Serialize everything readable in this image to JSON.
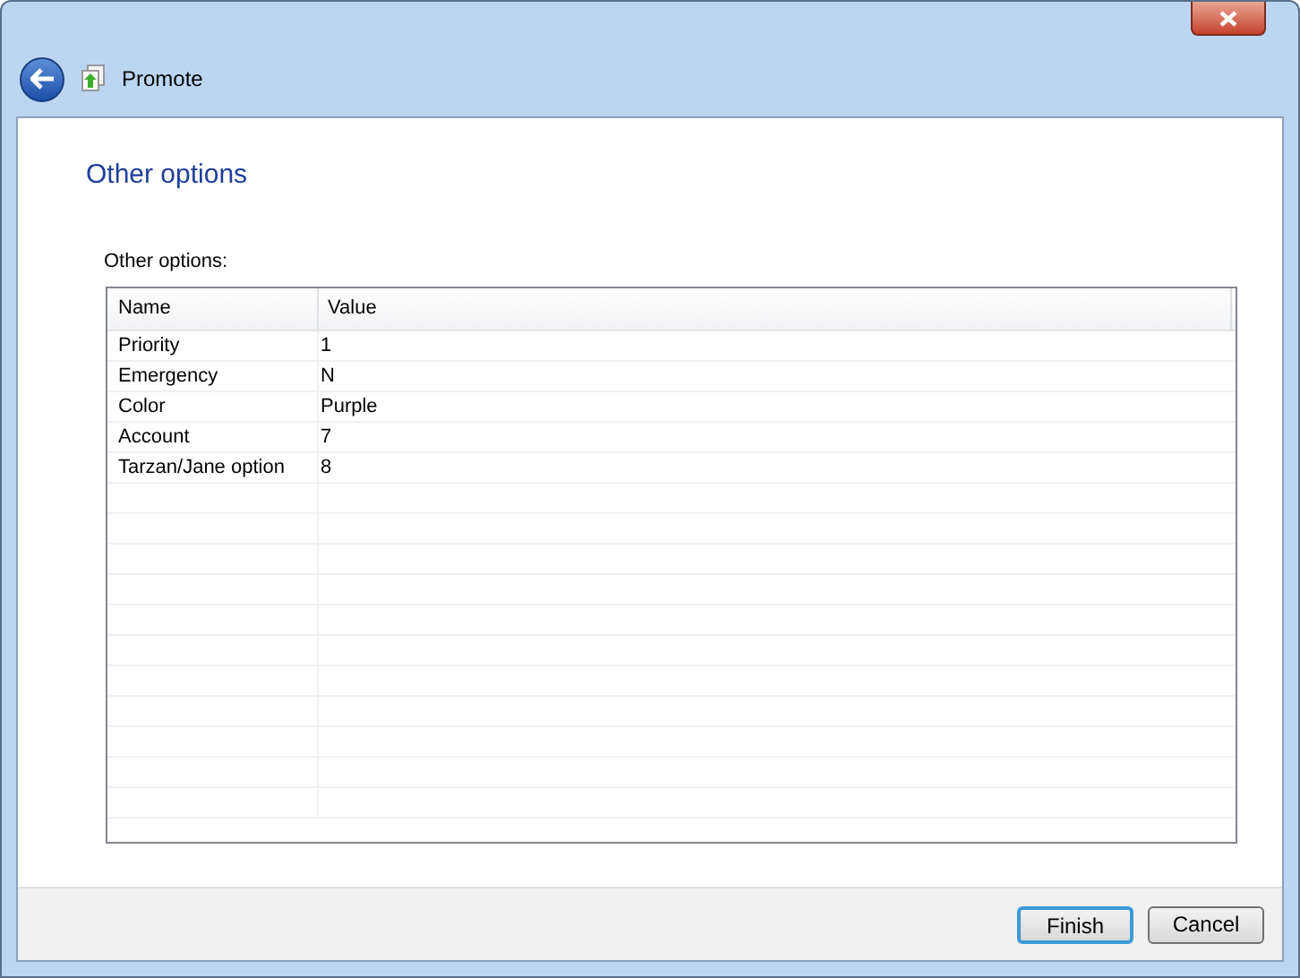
{
  "window": {
    "title": "Promote"
  },
  "page": {
    "heading": "Other options",
    "table_label": "Other options:"
  },
  "table": {
    "columns": [
      "Name",
      "Value"
    ],
    "rows": [
      [
        "Priority",
        "1"
      ],
      [
        "Emergency",
        "N"
      ],
      [
        "Color",
        "Purple"
      ],
      [
        "Account",
        "7"
      ],
      [
        "Tarzan/Jane option",
        "8"
      ]
    ]
  },
  "buttons": [
    {
      "label": "Finish",
      "default": true
    },
    {
      "label": "Cancel",
      "default": false
    }
  ]
}
